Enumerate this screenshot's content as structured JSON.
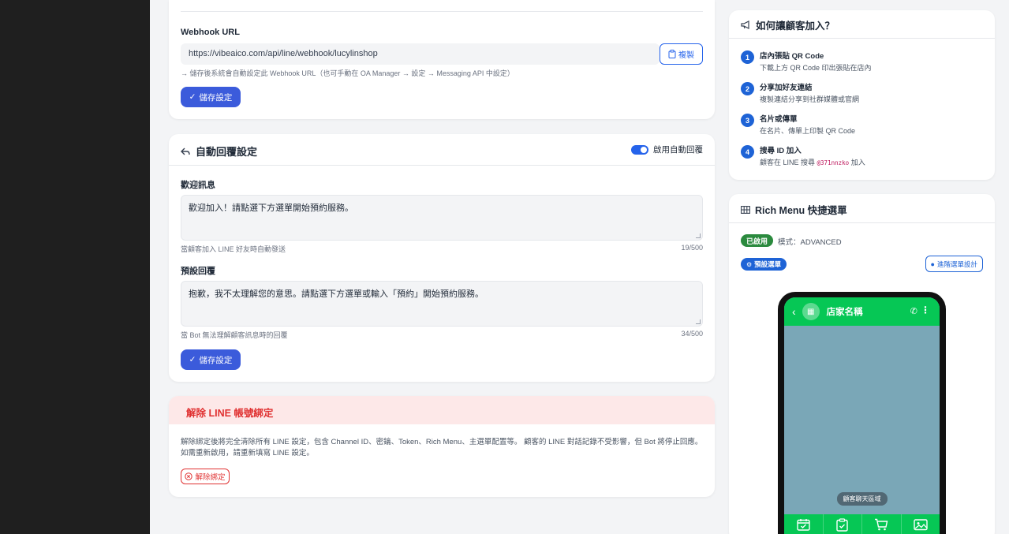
{
  "webhook": {
    "label": "Webhook URL",
    "url": "https://vibeaico.com/api/line/webhook/lucylinshop",
    "copy_label": "複製",
    "hint": "→ 儲存後系統會自動設定此 Webhook URL（也可手動在 OA Manager → 設定 → Messaging API 中設定）",
    "save_label": "儲存設定"
  },
  "auto_reply": {
    "title": "自動回覆設定",
    "toggle_label": "啟用自動回覆",
    "welcome": {
      "label": "歡迎訊息",
      "value": "歡迎加入！請點選下方選單開始預約服務。",
      "hint": "當顧客加入 LINE 好友時自動發送",
      "count": "19/500"
    },
    "default_reply": {
      "label": "預設回覆",
      "value": "抱歉，我不太理解您的意思。請點選下方選單或輸入「預約」開始預約服務。",
      "hint": "當 Bot 無法理解顧客訊息時的回覆",
      "count": "34/500"
    },
    "save_label": "儲存設定"
  },
  "unbind": {
    "title": "解除 LINE 帳號綁定",
    "text_line1": "解除綁定後將完全清除所有 LINE 設定，包含 Channel ID、密鑰、Token、Rich Menu、主選單配置等。 顧客的 LINE 對話記錄不受影響，但 Bot 將停止回應。",
    "text_line2": "如需重新啟用，請重新填寫 LINE 設定。",
    "button_label": "解除綁定"
  },
  "how_to": {
    "title": "如何讓顧客加入？",
    "steps": [
      {
        "num": "1",
        "title": "店內張貼 QR Code",
        "desc": "下載上方 QR Code 印出張貼在店內"
      },
      {
        "num": "2",
        "title": "分享加好友連結",
        "desc": "複製連結分享到社群媒體或官網"
      },
      {
        "num": "3",
        "title": "名片或傳單",
        "desc": "在名片、傳單上印製 QR Code"
      },
      {
        "num": "4",
        "title": "搜尋 ID 加入",
        "desc_prefix": "顧客在 LINE 搜尋",
        "code": "@371nnzko",
        "desc_suffix": "加入"
      }
    ]
  },
  "rich_menu": {
    "title": "Rich Menu 快捷選單",
    "status_badge": "已啟用",
    "mode": "模式：ADVANCED",
    "preset_badge": "預設選單",
    "advanced_button": "進階選單設計",
    "phone": {
      "shop_name": "店家名稱",
      "chat_chip": "顧客聊天區域",
      "menu_icons": [
        "calendar-check-icon",
        "clipboard-check-icon",
        "cart-icon",
        "image-icon"
      ]
    }
  },
  "colors": {
    "primary": "#3b5bdb",
    "danger": "#e03131",
    "line_green": "#06c755",
    "enabled_green": "#2b8a3e"
  }
}
